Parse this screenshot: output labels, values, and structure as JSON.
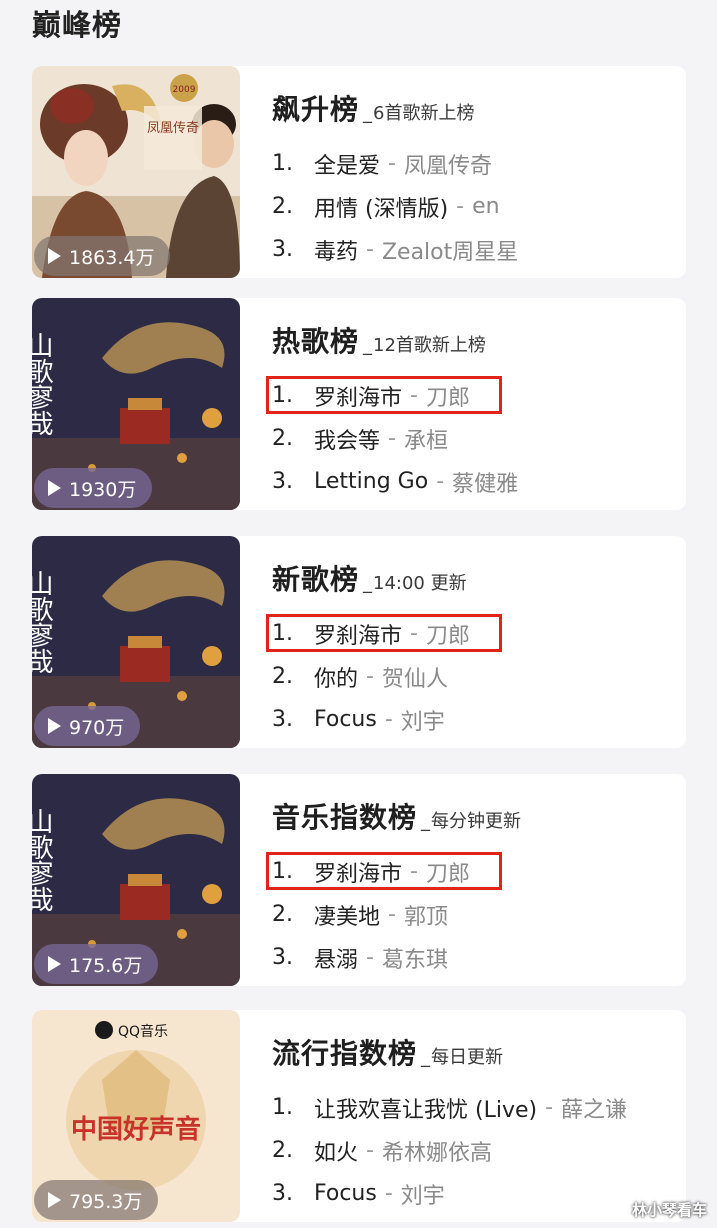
{
  "page": {
    "title": "巅峰榜"
  },
  "charts": [
    {
      "name": "飙升榜",
      "tag": "6首歌新上榜",
      "play_count": "1863.4万",
      "songs": [
        {
          "rank": "1.",
          "title": "全是爱",
          "artist": "凤凰传奇"
        },
        {
          "rank": "2.",
          "title": "用情 (深情版)",
          "artist": "en"
        },
        {
          "rank": "3.",
          "title": "毒药",
          "artist": "Zealot周星星"
        }
      ]
    },
    {
      "name": "热歌榜",
      "tag": "12首歌新上榜",
      "play_count": "1930万",
      "songs": [
        {
          "rank": "1.",
          "title": "罗刹海市",
          "artist": "刀郎"
        },
        {
          "rank": "2.",
          "title": "我会等",
          "artist": "承桓"
        },
        {
          "rank": "3.",
          "title": "Letting Go",
          "artist": "蔡健雅"
        }
      ]
    },
    {
      "name": "新歌榜",
      "tag": "14:00 更新",
      "play_count": "970万",
      "songs": [
        {
          "rank": "1.",
          "title": "罗刹海市",
          "artist": "刀郎"
        },
        {
          "rank": "2.",
          "title": "你的",
          "artist": "贺仙人"
        },
        {
          "rank": "3.",
          "title": "Focus",
          "artist": "刘宇"
        }
      ]
    },
    {
      "name": "音乐指数榜",
      "tag": "每分钟更新",
      "play_count": "175.6万",
      "songs": [
        {
          "rank": "1.",
          "title": "罗刹海市",
          "artist": "刀郎"
        },
        {
          "rank": "2.",
          "title": "凄美地",
          "artist": "郭顶"
        },
        {
          "rank": "3.",
          "title": "悬溺",
          "artist": "葛东琪"
        }
      ]
    },
    {
      "name": "流行指数榜",
      "tag": "每日更新",
      "play_count": "795.3万",
      "songs": [
        {
          "rank": "1.",
          "title": "让我欢喜让我忧 (Live)",
          "artist": "薛之谦"
        },
        {
          "rank": "2.",
          "title": "如火",
          "artist": "希林娜依高"
        },
        {
          "rank": "3.",
          "title": "Focus",
          "artist": "刘宇"
        }
      ]
    }
  ],
  "covers": {
    "fenghuang": {
      "brand_text": "凤凰传奇",
      "year": "2009"
    },
    "shange": {
      "title_text": "山歌寥哉"
    },
    "haoshengyin": {
      "brand_text": "QQ音乐",
      "title_text": "中国好声音"
    }
  },
  "song_separator": "-",
  "watermark": "林小琴看车",
  "highlight_color": "#e2231a",
  "icons": {
    "play": "play-icon"
  }
}
